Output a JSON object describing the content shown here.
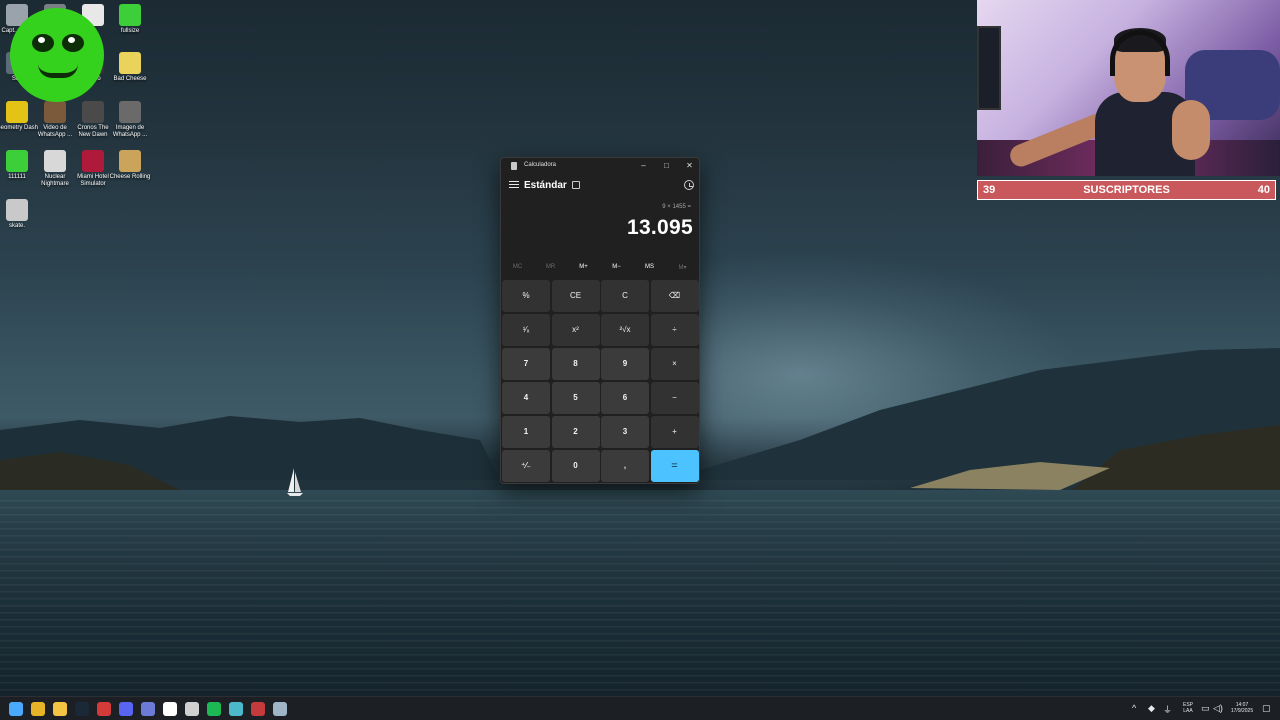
{
  "desktop": {
    "icons": [
      {
        "label": "Capt... pa...",
        "icon": "capture-app-icon",
        "color": "#9aa3ab"
      },
      {
        "label": "",
        "icon": "app-icon",
        "color": "#7a7f85"
      },
      {
        "label": "",
        "icon": "document-icon",
        "color": "#e8e8e8"
      },
      {
        "label": "fullsize",
        "icon": "fullsize-icon",
        "color": "#3ccf3a"
      },
      {
        "label": "Sl...",
        "icon": "app-icon",
        "color": "#5b6b7a"
      },
      {
        "label": "...rmo",
        "icon": "app-icon",
        "color": "#333"
      },
      {
        "label": "Bad Cheese",
        "icon": "bad-cheese-icon",
        "color": "#e9d35a"
      },
      {
        "label": "Geometry Dash",
        "icon": "geometry-dash-icon",
        "color": "#e3c315"
      },
      {
        "label": "Video de WhatsApp ...",
        "icon": "video-icon",
        "color": "#7a5a3a"
      },
      {
        "label": "Cronos The New Dawn",
        "icon": "cronos-icon",
        "color": "#4a4a4a"
      },
      {
        "label": "Imagen de WhatsApp ...",
        "icon": "image-icon",
        "color": "#6a6a6a"
      },
      {
        "label": "111111",
        "icon": "green-face-icon",
        "color": "#3ccf3a"
      },
      {
        "label": "Nuclear Nightmare",
        "icon": "nuclear-nightmare-icon",
        "color": "#d8d8d8"
      },
      {
        "label": "Miami Hotel Simulator",
        "icon": "miami-hotel-icon",
        "color": "#b01a3a"
      },
      {
        "label": "Cheese Rolling",
        "icon": "cheese-rolling-icon",
        "color": "#c9a45a"
      },
      {
        "label": "skate.",
        "icon": "skate-icon",
        "color": "#c9c9c9"
      }
    ]
  },
  "overlay": {
    "sub_left": "39",
    "sub_center": "SUSCRIPTORES",
    "sub_right": "40"
  },
  "calculator": {
    "title": "Calculadora",
    "mode": "Estándar",
    "expression": "9 × 1455 =",
    "result": "13.095",
    "memory": [
      {
        "label": "MC",
        "enabled": false
      },
      {
        "label": "MR",
        "enabled": false
      },
      {
        "label": "M+",
        "enabled": true
      },
      {
        "label": "M−",
        "enabled": true
      },
      {
        "label": "MS",
        "enabled": true
      },
      {
        "label": "M▾",
        "enabled": false
      }
    ],
    "keys": [
      {
        "label": "%",
        "kind": "fn",
        "name": "percent-button"
      },
      {
        "label": "CE",
        "kind": "fn",
        "name": "clear-entry-button"
      },
      {
        "label": "C",
        "kind": "fn",
        "name": "clear-button"
      },
      {
        "label": "⌫",
        "kind": "fn",
        "name": "backspace-button"
      },
      {
        "label": "¹⁄ₓ",
        "kind": "fn",
        "name": "reciprocal-button"
      },
      {
        "label": "x²",
        "kind": "fn",
        "name": "square-button"
      },
      {
        "label": "²√x",
        "kind": "fn",
        "name": "square-root-button"
      },
      {
        "label": "÷",
        "kind": "fn",
        "name": "divide-button"
      },
      {
        "label": "7",
        "kind": "num",
        "name": "digit-7-button"
      },
      {
        "label": "8",
        "kind": "num",
        "name": "digit-8-button"
      },
      {
        "label": "9",
        "kind": "num",
        "name": "digit-9-button"
      },
      {
        "label": "×",
        "kind": "fn",
        "name": "multiply-button"
      },
      {
        "label": "4",
        "kind": "num",
        "name": "digit-4-button"
      },
      {
        "label": "5",
        "kind": "num",
        "name": "digit-5-button"
      },
      {
        "label": "6",
        "kind": "num",
        "name": "digit-6-button"
      },
      {
        "label": "−",
        "kind": "fn",
        "name": "subtract-button"
      },
      {
        "label": "1",
        "kind": "num",
        "name": "digit-1-button"
      },
      {
        "label": "2",
        "kind": "num",
        "name": "digit-2-button"
      },
      {
        "label": "3",
        "kind": "num",
        "name": "digit-3-button"
      },
      {
        "label": "+",
        "kind": "fn",
        "name": "add-button"
      },
      {
        "label": "⁺⁄₋",
        "kind": "num",
        "name": "negate-button"
      },
      {
        "label": "0",
        "kind": "num",
        "name": "digit-0-button"
      },
      {
        "label": ",",
        "kind": "num",
        "name": "decimal-button"
      },
      {
        "label": "=",
        "kind": "eq",
        "name": "equals-button"
      }
    ]
  },
  "taskbar": {
    "apps": [
      {
        "icon": "start-icon",
        "color": "#4aa8ff"
      },
      {
        "icon": "chrome-icon",
        "color": "#e6b427"
      },
      {
        "icon": "file-explorer-icon",
        "color": "#f4c542"
      },
      {
        "icon": "steam-icon",
        "color": "#1b2838"
      },
      {
        "icon": "browser-icon",
        "color": "#d33b3b"
      },
      {
        "icon": "discord-icon",
        "color": "#5865f2"
      },
      {
        "icon": "chat-icon",
        "color": "#6b7bd6"
      },
      {
        "icon": "capcut-icon",
        "color": "#ffffff"
      },
      {
        "icon": "media-icon",
        "color": "#d0d0d0"
      },
      {
        "icon": "spotify-icon",
        "color": "#1db954"
      },
      {
        "icon": "launcher-icon",
        "color": "#4bb9c9"
      },
      {
        "icon": "game-icon",
        "color": "#c33b3b"
      },
      {
        "icon": "calculator-icon",
        "color": "#9fb6c8"
      }
    ],
    "lang_top": "ESP",
    "lang_bottom": "LAA",
    "time": "14:07",
    "date": "17/9/2025"
  }
}
